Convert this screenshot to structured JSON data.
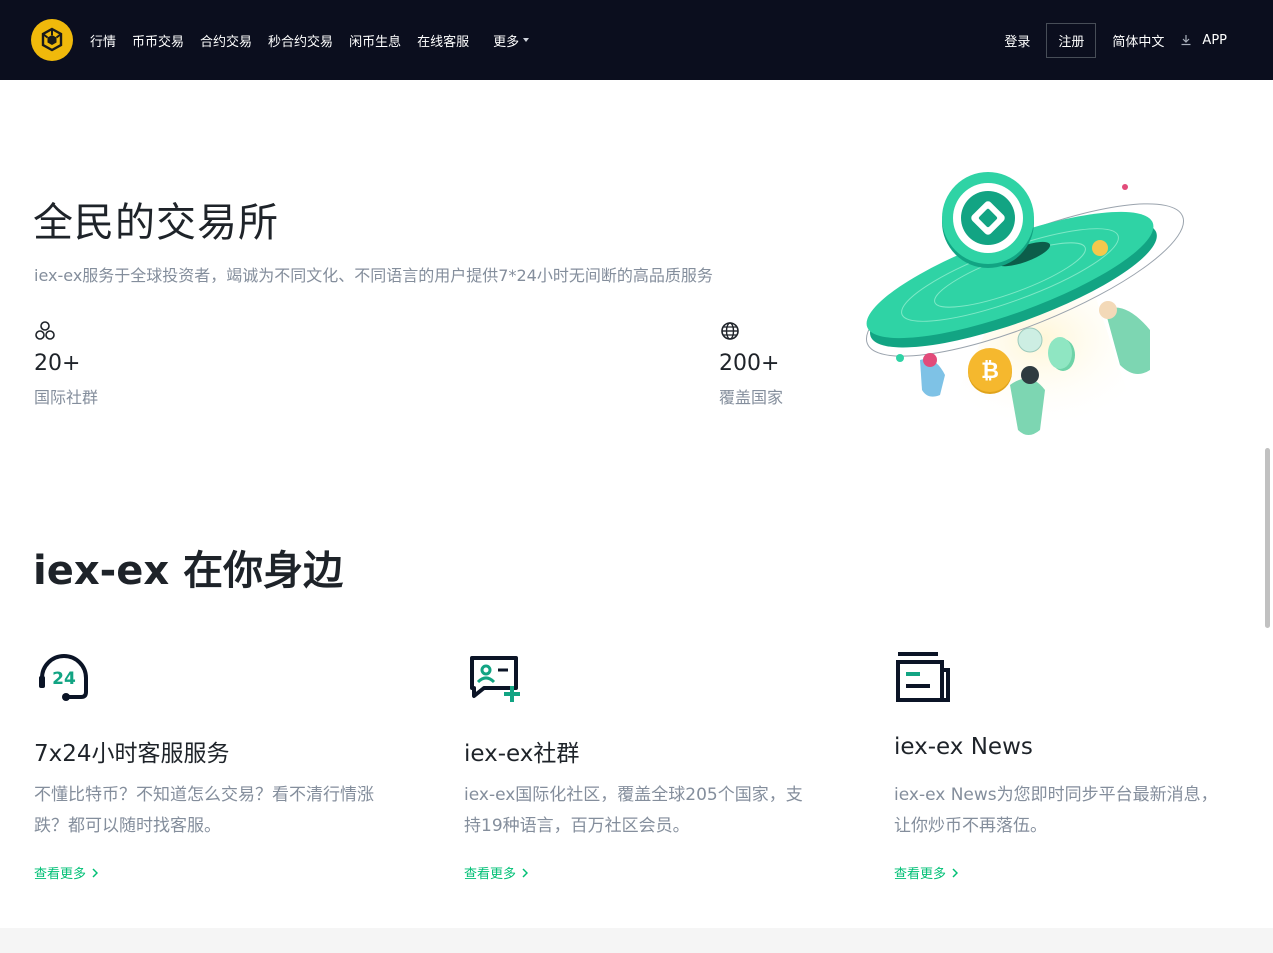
{
  "nav": {
    "links": [
      "行情",
      "币币交易",
      "合约交易",
      "秒合约交易",
      "闲币生息",
      "在线客服"
    ],
    "more_label": "更多",
    "login_label": "登录",
    "register_label": "注册",
    "language_label": "简体中文",
    "app_label": "APP"
  },
  "hero": {
    "title": "全民的交易所",
    "subtitle": "iex-ex服务于全球投资者，竭诚为不同文化、不同语言的用户提供7*24小时无间断的高品质服务",
    "stats": [
      {
        "icon": "community-icon",
        "value": "20+",
        "label": "国际社群"
      },
      {
        "icon": "globe-icon",
        "value": "200+",
        "label": "覆盖国家"
      }
    ]
  },
  "section": {
    "title": "iex-ex 在你身边",
    "cards": [
      {
        "icon": "support-24h-icon",
        "title": "7x24小时客服服务",
        "desc": "不懂比特币？不知道怎么交易？看不清行情涨跌？都可以随时找客服。",
        "more": "查看更多"
      },
      {
        "icon": "community-chat-icon",
        "title": "iex-ex社群",
        "desc": "iex-ex国际化社区，覆盖全球205个国家，支持19种语言，百万社区会员。",
        "more": "查看更多"
      },
      {
        "icon": "news-icon",
        "title": "iex-ex News",
        "desc": "iex-ex News为您即时同步平台最新消息，让你炒币不再落伍。",
        "more": "查看更多"
      }
    ]
  },
  "colors": {
    "nav_bg": "#0b0e1e",
    "brand_yellow": "#f0b90b",
    "accent_green": "#02c076",
    "text_primary": "#1e2329",
    "text_secondary": "#848e9c"
  }
}
